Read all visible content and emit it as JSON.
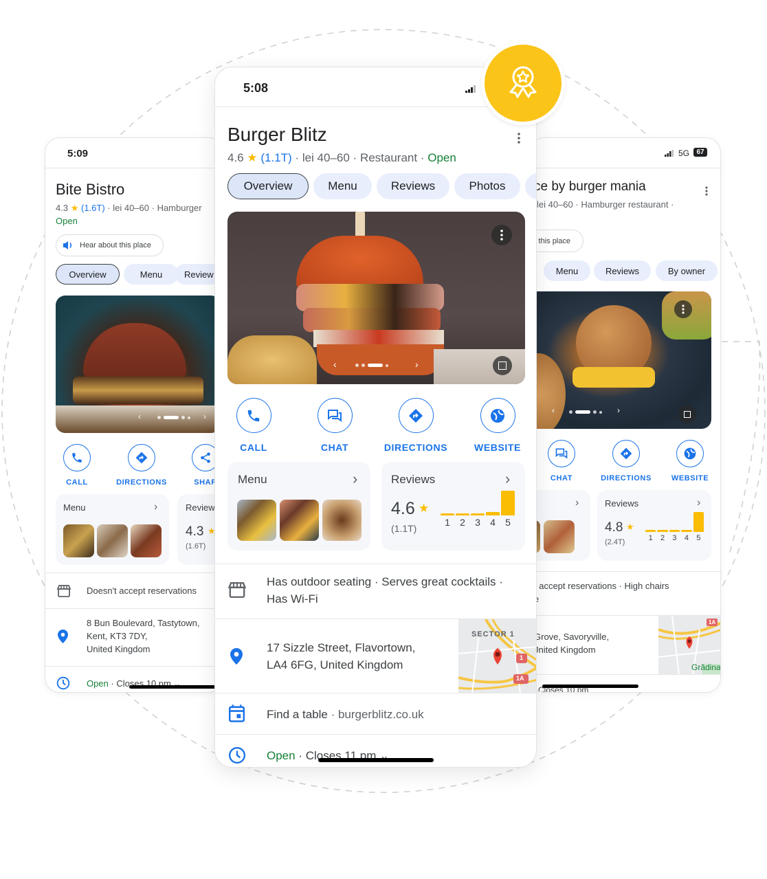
{
  "badge": {
    "icon": "award-ribbon-icon",
    "color": "#fbc418"
  },
  "colors": {
    "accent": "#1a73e8",
    "open": "#188038",
    "star": "#fbbc04",
    "bar": "#fbbc04"
  },
  "center": {
    "status_time": "5:08",
    "title": "Burger Blitz",
    "rating": "4.6",
    "review_count": "(1.1T)",
    "price": "lei 40–60",
    "category": "Restaurant",
    "status": "Open",
    "tabs": [
      "Overview",
      "Menu",
      "Reviews",
      "Photos"
    ],
    "selected_tab": "Overview",
    "photo_carousel": {
      "count": 4,
      "active": 3
    },
    "actions": [
      {
        "label": "CALL",
        "icon": "phone-icon"
      },
      {
        "label": "CHAT",
        "icon": "chat-icon"
      },
      {
        "label": "DIRECTIONS",
        "icon": "directions-icon"
      },
      {
        "label": "WEBSITE",
        "icon": "globe-icon"
      }
    ],
    "menu_card": {
      "title": "Menu"
    },
    "reviews_card": {
      "title": "Reviews",
      "rating": "4.6",
      "count": "(1.1T)",
      "distribution": {
        "labels": [
          "1",
          "2",
          "3",
          "4",
          "5"
        ],
        "values": [
          0.08,
          0.06,
          0.07,
          0.14,
          1.0
        ]
      }
    },
    "amenities": "Has outdoor seating · Serves great cocktails · Has Wi-Fi",
    "address_line1": "17 Sizzle Street, Flavortown,",
    "address_line2": "LA4 6FG, United Kingdom",
    "map_label": "SECTOR 1",
    "map_shields": [
      "1",
      "1A"
    ],
    "reserve": "Find a table",
    "website": "burgerblitz.co.uk",
    "hours_status": "Open",
    "hours_close": "Closes 11 pm"
  },
  "left": {
    "status_time": "5:09",
    "title": "Bite Bistro",
    "rating": "4.3",
    "review_count": "(1.6T)",
    "price": "lei 40–60",
    "category": "Hamburger",
    "status": "Open",
    "hear_button": "Hear about this place",
    "tabs": [
      "Overview",
      "Menu",
      "Review"
    ],
    "selected_tab": "Overview",
    "actions": [
      {
        "label": "CALL",
        "icon": "phone-icon"
      },
      {
        "label": "DIRECTIONS",
        "icon": "directions-icon"
      },
      {
        "label": "SHAR",
        "icon": "share-icon"
      }
    ],
    "menu_card": {
      "title": "Menu"
    },
    "reviews_card": {
      "title": "Review",
      "rating": "4.3",
      "count": "(1.6T)"
    },
    "reservations": "Doesn't accept reservations",
    "address_line1": "8 Bun Boulevard, Tastytown,",
    "address_line2": "Kent,  KT3 7DY,",
    "address_line3": "United Kingdom",
    "hours_status": "Open",
    "hours_close": "Closes 10 pm"
  },
  "right": {
    "status_network": "5G",
    "battery": "67",
    "title": "ce by burger mania",
    "meta": "lei 40–60 · Hamburger restaurant ·",
    "hear_button": "this place",
    "tabs": [
      "Menu",
      "Reviews",
      "By owner"
    ],
    "actions": [
      {
        "label": "CHAT",
        "icon": "chat-icon"
      },
      {
        "label": "DIRECTIONS",
        "icon": "directions-icon"
      },
      {
        "label": "WEBSITE",
        "icon": "globe-icon"
      }
    ],
    "reviews_card": {
      "title": "Reviews",
      "rating": "4.8",
      "count": "(2.4T)",
      "distribution": {
        "labels": [
          "1",
          "2",
          "3",
          "4",
          "5"
        ],
        "values": [
          0.04,
          0.04,
          0.04,
          0.11,
          1.0
        ]
      }
    },
    "amenities_line1": ": accept reservations · High chairs",
    "amenities_line2": "e",
    "address_line1": "Grove, Savoryville,",
    "address_line2": "Jnited Kingdom",
    "map_label": "Grădina",
    "map_shield": "1A",
    "hours_close": "Closes 10 pm"
  }
}
